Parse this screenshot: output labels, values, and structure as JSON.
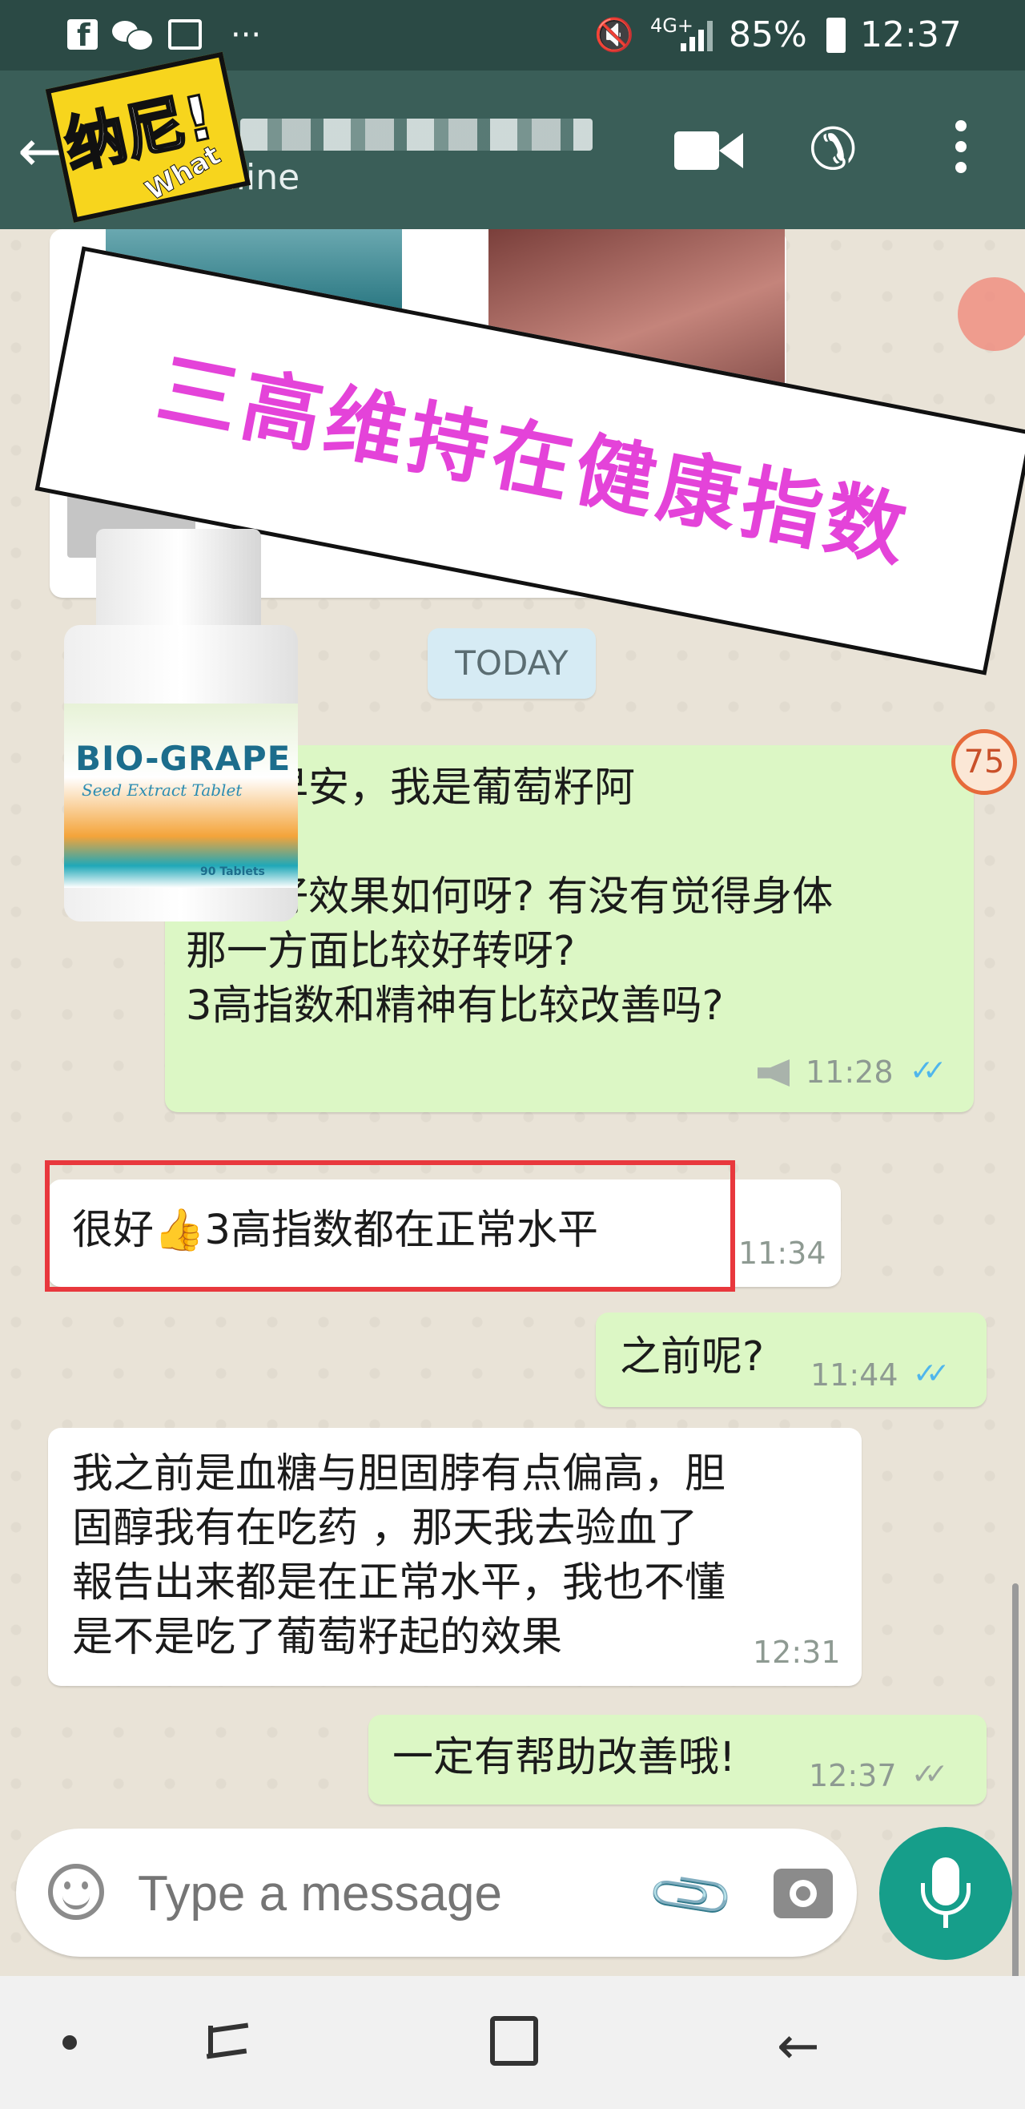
{
  "status_bar": {
    "network": "4G+",
    "battery": "85%",
    "time": "12:37"
  },
  "app_bar": {
    "status": "online"
  },
  "sticker": {
    "main": "纳尼!",
    "sub": "What"
  },
  "overlay_banner": "三高维持在健康指数",
  "product": {
    "brand": "BIO-GRAPE",
    "subtitle": "Seed Extract Tablet",
    "count": "90 Tablets"
  },
  "date_chip": "TODAY",
  "unread_badge": "75",
  "messages": [
    {
      "dir": "out",
      "text": "早安早安，我是葡萄籽阿\n妹。\n葡萄籽效果如何呀? 有没有觉得身体\n那一方面比较好转呀?\n3高指数和精神有比较改善吗?",
      "time": "11:28",
      "ticks": "✓✓"
    },
    {
      "dir": "in",
      "text": "很好👍3高指数都在正常水平",
      "time": "11:34"
    },
    {
      "dir": "out",
      "text": "之前呢?",
      "time": "11:44",
      "ticks": "✓✓"
    },
    {
      "dir": "in",
      "text": "我之前是血糖与胆固脖有点偏高，胆\n固醇我有在吃药 ，那天我去验血了\n報告出来都是在正常水平，我也不懂\n是不是吃了葡萄籽起的效果",
      "time": "12:31"
    },
    {
      "dir": "out",
      "text": "一定有帮助改善哦!",
      "time": "12:37",
      "ticks": "✓✓"
    }
  ],
  "input": {
    "placeholder": "Type a message"
  },
  "colors": {
    "header": "#3a5e58",
    "outgoing_bubble": "#dcf7c5",
    "incoming_bubble": "#ffffff",
    "accent": "#169e8a",
    "banner_text": "#e443d9",
    "highlight_box": "#e8383d"
  }
}
